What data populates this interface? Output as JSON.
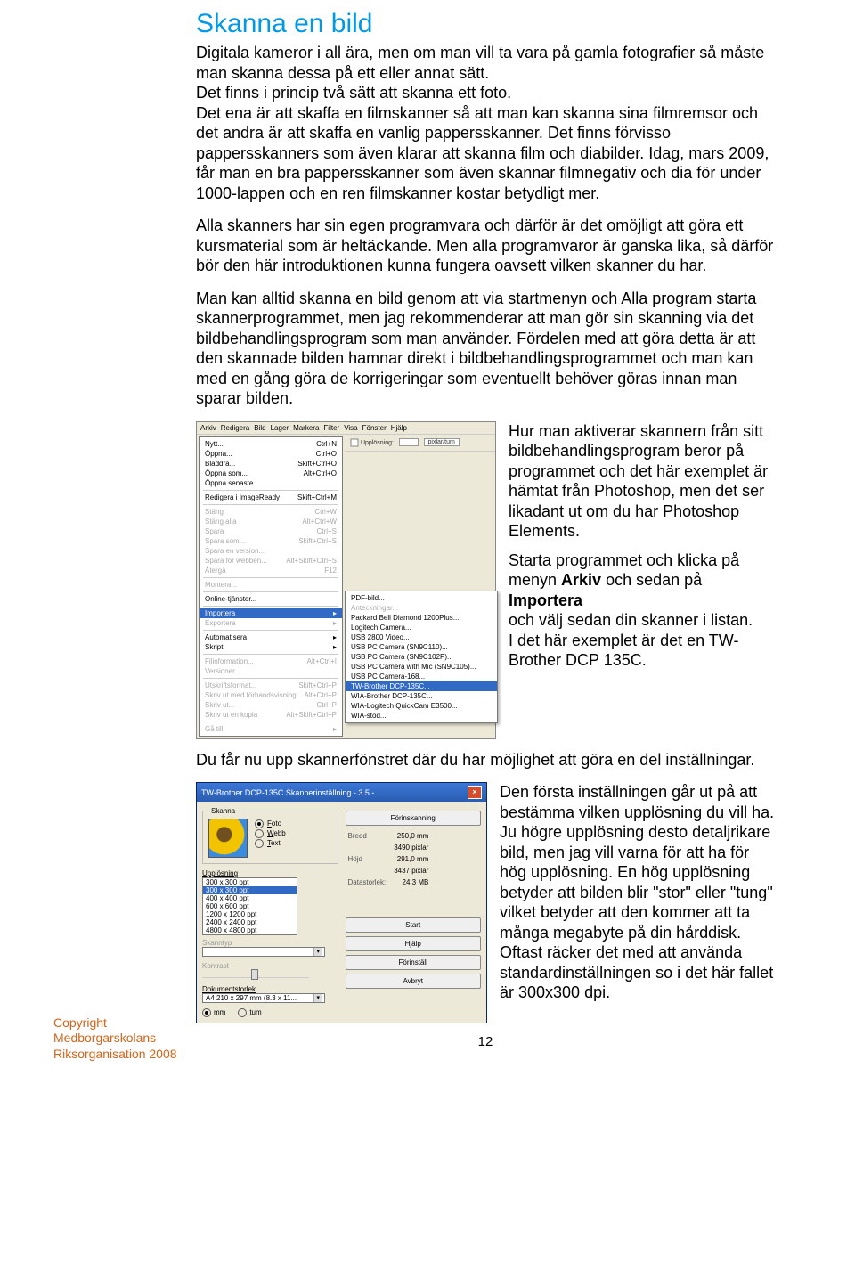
{
  "title": "Skanna en bild",
  "paragraphs": {
    "p1": "Digitala kameror i all ära, men om man vill ta vara på gamla fotografier så måste man skanna dessa på ett eller annat sätt.",
    "p1b": "Det finns i princip två sätt att skanna ett foto.",
    "p1c": "Det ena är att skaffa en filmskanner så att man kan skanna sina filmremsor och det andra är att skaffa en vanlig pappersskanner. Det finns förvisso pappersskanners som även klarar att skanna film och diabilder. Idag, mars 2009, får man en bra pappersskanner som även skannar filmnegativ och dia för under 1000-lappen och en ren filmskanner kostar betydligt mer.",
    "p2": "Alla skanners har sin egen programvara och därför är det omöjligt att göra ett kursmaterial som är heltäckande. Men alla programvaror är ganska lika, så därför bör den här introduktionen kunna fungera oavsett vilken skanner du har.",
    "p3": "Man kan alltid skanna en bild genom att via startmenyn och Alla program starta skannerprogrammet, men jag rekommenderar att man gör sin skanning via det bildbehandlingsprogram som man använder. Fördelen med att göra detta är att den skannade bilden hamnar direkt i bildbehandlingsprogrammet och man kan med en gång göra de korrigeringar som eventuellt behöver göras innan man sparar bilden.",
    "p4": "Hur man aktiverar skannern från sitt bildbehandlingsprogram beror på programmet och det här exemplet är hämtat från Photoshop, men det ser likadant ut om du har Photoshop Elements.",
    "p5a": "Starta programmet och klicka på menyn ",
    "p5b": " och sedan på ",
    "p5d": "och välj sedan din skanner i listan.",
    "p5e": "I det här exemplet är det en TW-Brother DCP 135C.",
    "p5_bold1": "Arkiv",
    "p5_bold2": "Importera",
    "p6": "Du får nu upp skannerfönstret där du har möjlighet att göra en del inställningar.",
    "p7": "Den första inställningen går ut på att bestämma vilken upplösning du vill ha. Ju högre upplösning desto detaljrikare bild, men jag vill varna för att ha för hög upplösning. En hög upplösning betyder att bilden blir \"stor\" eller \"tung\" vilket betyder att den kommer att ta många megabyte på din hårddisk. Oftast räcker det med att använda standardinställningen so i det här fallet är 300x300 dpi."
  },
  "menu": {
    "bar": [
      "Arkiv",
      "Redigera",
      "Bild",
      "Lager",
      "Markera",
      "Filter",
      "Visa",
      "Fönster",
      "Hjälp"
    ],
    "toolbar_label": "Upplösning:",
    "toolbar_unit": "pixlar/tum",
    "items": [
      {
        "l": "Nytt...",
        "r": "Ctrl+N",
        "dis": false
      },
      {
        "l": "Öppna...",
        "r": "Ctrl+O",
        "dis": false
      },
      {
        "l": "Bläddra...",
        "r": "Skift+Ctrl+O",
        "dis": false
      },
      {
        "l": "Öppna som...",
        "r": "Alt+Ctrl+O",
        "dis": false
      },
      {
        "l": "Öppna senaste",
        "r": "",
        "dis": false
      },
      {
        "sep": true
      },
      {
        "l": "Redigera i ImageReady",
        "r": "Skift+Ctrl+M",
        "dis": false
      },
      {
        "sep": true
      },
      {
        "l": "Stäng",
        "r": "Ctrl+W",
        "dis": true
      },
      {
        "l": "Stäng alla",
        "r": "Alt+Ctrl+W",
        "dis": true
      },
      {
        "l": "Spara",
        "r": "Ctrl+S",
        "dis": true
      },
      {
        "l": "Spara som...",
        "r": "Skift+Ctrl+S",
        "dis": true
      },
      {
        "l": "Spara en version...",
        "r": "",
        "dis": true
      },
      {
        "l": "Spara för webben...",
        "r": "Alt+Skift+Ctrl+S",
        "dis": true
      },
      {
        "l": "Återgå",
        "r": "F12",
        "dis": true
      },
      {
        "sep": true
      },
      {
        "l": "Montera...",
        "r": "",
        "dis": true
      },
      {
        "sep": true
      },
      {
        "l": "Online-tjänster...",
        "r": "",
        "dis": false
      },
      {
        "sep": true
      },
      {
        "l": "Importera",
        "r": "▸",
        "dis": false,
        "hl": true
      },
      {
        "l": "Exportera",
        "r": "▸",
        "dis": true
      },
      {
        "sep": true
      },
      {
        "l": "Automatisera",
        "r": "▸",
        "dis": false
      },
      {
        "l": "Skript",
        "r": "▸",
        "dis": false
      },
      {
        "sep": true
      },
      {
        "l": "Filinformation...",
        "r": "Alt+Ctrl+I",
        "dis": true
      },
      {
        "l": "Versioner...",
        "r": "",
        "dis": true
      },
      {
        "sep": true
      },
      {
        "l": "Utskriftsformat...",
        "r": "Skift+Ctrl+P",
        "dis": true
      },
      {
        "l": "Skriv ut med förhandsvisning...",
        "r": "Alt+Ctrl+P",
        "dis": true
      },
      {
        "l": "Skriv ut...",
        "r": "Ctrl+P",
        "dis": true
      },
      {
        "l": "Skriv ut en kopia",
        "r": "Alt+Skift+Ctrl+P",
        "dis": true
      },
      {
        "sep": true
      },
      {
        "l": "Gå till",
        "r": "▸",
        "dis": true
      }
    ],
    "submenu": [
      {
        "l": "PDF-bild...",
        "dis": false
      },
      {
        "l": "Anteckningar...",
        "dis": true
      },
      {
        "l": "Packard Bell Diamond 1200Plus...",
        "dis": false
      },
      {
        "l": "Logitech Camera...",
        "dis": false
      },
      {
        "l": "USB 2800 Video...",
        "dis": false
      },
      {
        "l": "USB PC Camera (SN9C110)...",
        "dis": false
      },
      {
        "l": "USB PC Camera (SN9C102P)...",
        "dis": false
      },
      {
        "l": "USB PC Camera with Mic (SN9C105)...",
        "dis": false
      },
      {
        "l": "USB PC Camera-168...",
        "dis": false
      },
      {
        "l": "TW-Brother DCP-135C...",
        "dis": false,
        "hl": true
      },
      {
        "l": "WIA-Brother DCP-135C...",
        "dis": false
      },
      {
        "l": "WIA-Logitech QuickCam E3500...",
        "dis": false
      },
      {
        "l": "WIA-stöd...",
        "dis": false
      }
    ]
  },
  "dialog": {
    "title": "TW-Brother DCP-135C Skannerinställning - 3.5 -",
    "group_scan": "Skanna",
    "radios": [
      {
        "l": "Foto",
        "on": true,
        "key": "F"
      },
      {
        "l": "Webb",
        "on": false,
        "key": "W"
      },
      {
        "l": "Text",
        "on": false,
        "key": "T"
      }
    ],
    "res_label": "Upplösning",
    "res_options": [
      "300 x 300 ppt",
      "300 x 300 ppt",
      "400 x 400 ppt",
      "600 x 600 ppt",
      "1200 x 1200 ppt",
      "2400 x 2400 ppt",
      "4800 x 4800 ppt"
    ],
    "scantype_label": "Skanntyp",
    "contrast_label": "Kontrast",
    "docsize_label": "Dokumentstorlek",
    "docsize_value": "A4 210 x 297 mm (8.3 x 11...",
    "unit_radios": [
      {
        "l": "mm",
        "on": true
      },
      {
        "l": "tum",
        "on": false
      }
    ],
    "btn_prescan": "Förinskanning",
    "info": [
      [
        "Bredd",
        "250,0 mm"
      ],
      [
        "",
        "3490 pixlar"
      ],
      [
        "Höjd",
        "291,0 mm"
      ],
      [
        "",
        "3437 pixlar"
      ],
      [
        "Datastorlek:",
        "24,3 MB"
      ]
    ],
    "btns": [
      "Start",
      "Hjälp",
      "Förinställ",
      "Avbryt"
    ]
  },
  "footer": {
    "l1": "Copyright",
    "l2": "Medborgarskolans",
    "l3": "Riksorganisation 2008"
  },
  "pagenum": "12"
}
